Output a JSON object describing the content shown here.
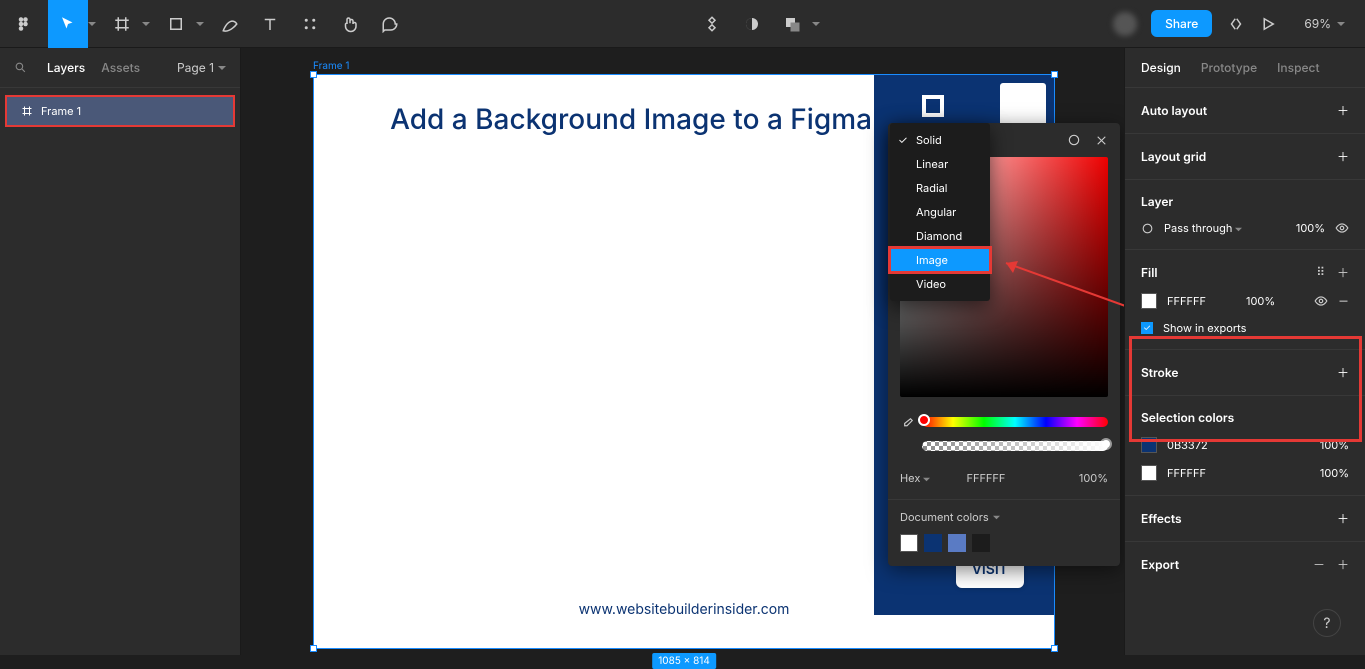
{
  "toolbar": {
    "zoom": "69%",
    "share": "Share"
  },
  "leftPanel": {
    "tabs": {
      "layers": "Layers",
      "assets": "Assets"
    },
    "page": "Page 1",
    "layer": "Frame 1"
  },
  "canvas": {
    "frameLabel": "Frame 1",
    "title": "Add a Background Image to a Figma Frame?",
    "url": "www.websitebuilderinsider.com",
    "visit": "VISIT",
    "dimensions": "1085 × 814"
  },
  "colorDropdown": {
    "items": [
      "Solid",
      "Linear",
      "Radial",
      "Angular",
      "Diamond",
      "Image",
      "Video"
    ],
    "selected": "Image",
    "checked": "Solid"
  },
  "colorPicker": {
    "hexLabel": "Hex",
    "hexValue": "FFFFFF",
    "opacity": "100%",
    "docColorsLabel": "Document colors",
    "swatches": [
      "#ffffff",
      "#0b3372",
      "#5a7bc4",
      "#1c1c1c"
    ]
  },
  "rightPanel": {
    "tabs": {
      "design": "Design",
      "prototype": "Prototype",
      "inspect": "Inspect"
    },
    "autoLayout": "Auto layout",
    "layoutGrid": "Layout grid",
    "layer": {
      "title": "Layer",
      "blend": "Pass through",
      "opacity": "100%"
    },
    "fill": {
      "title": "Fill",
      "hex": "FFFFFF",
      "opacity": "100%",
      "showInExports": "Show in exports"
    },
    "stroke": "Stroke",
    "selectionColors": {
      "title": "Selection colors",
      "items": [
        {
          "hex": "0B3372",
          "opacity": "100%",
          "color": "#0b3372"
        },
        {
          "hex": "FFFFFF",
          "opacity": "100%",
          "color": "#ffffff"
        }
      ]
    },
    "effects": "Effects",
    "export": "Export"
  }
}
